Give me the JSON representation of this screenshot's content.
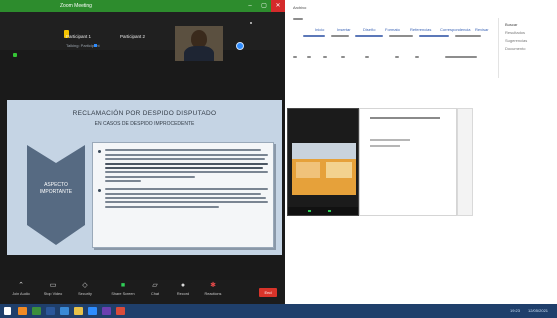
{
  "zoom": {
    "title": "Zoom Meeting",
    "header": {
      "name1": "Participant 1",
      "name2": "Participant 2",
      "subtitle": "Talking: Participant"
    },
    "slide": {
      "title": "RECLAMACIÓN POR DESPIDO DISPUTADO",
      "subtitle": "EN CASOS DE DESPIDO IMPROCEDENTE",
      "arrow_label": "ASPECTO\nIMPORTANTE"
    },
    "toolbar": {
      "items": [
        {
          "label": "Join Audio",
          "icon": "microphone-icon"
        },
        {
          "label": "Stop Video",
          "icon": "camera-icon"
        },
        {
          "label": "Security",
          "icon": "shield-icon"
        },
        {
          "label": "Participants",
          "icon": "people-icon"
        },
        {
          "label": "Chat",
          "icon": "chat-icon"
        },
        {
          "label": "Share Screen",
          "icon": "share-icon"
        },
        {
          "label": "Record",
          "icon": "record-icon"
        },
        {
          "label": "Reactions",
          "icon": "reactions-icon"
        }
      ],
      "end_label": "End"
    }
  },
  "word": {
    "ribbon": [
      "Archivo",
      "Inicio",
      "Insertar",
      "Diseño",
      "Formato",
      "Referencias",
      "Correspondencia",
      "Revisar",
      "Vista"
    ],
    "panel_title": "Buscar",
    "panel_lines": [
      "Resultados",
      "Sugerencias",
      "Documento"
    ]
  },
  "taskbar": {
    "time": "19:23",
    "date": "12/05/2021"
  },
  "colors": {
    "zoom_green": "#2d8c2d",
    "slide_bg": "#c5d4e4",
    "arrow": "#566a82",
    "end_red": "#d9342a",
    "taskbar": "#1f3f6b"
  }
}
